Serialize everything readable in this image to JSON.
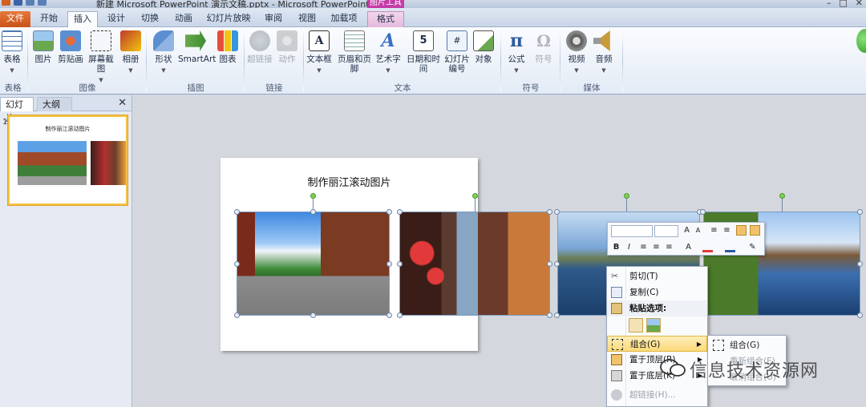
{
  "window": {
    "title": "新建 Microsoft PowerPoint 演示文稿.pptx - Microsoft PowerPoint",
    "context_tab_title": "图片工具",
    "controls": [
      "–",
      "□",
      "✕"
    ]
  },
  "tabs": [
    {
      "label": "文件",
      "state": "file"
    },
    {
      "label": "开始",
      "state": ""
    },
    {
      "label": "插入",
      "state": "active"
    },
    {
      "label": "设计",
      "state": ""
    },
    {
      "label": "切换",
      "state": ""
    },
    {
      "label": "动画",
      "state": ""
    },
    {
      "label": "幻灯片放映",
      "state": ""
    },
    {
      "label": "审阅",
      "state": ""
    },
    {
      "label": "视图",
      "state": ""
    },
    {
      "label": "加载项",
      "state": ""
    },
    {
      "label": "格式",
      "state": "ctx"
    }
  ],
  "ribbon": {
    "commands": [
      {
        "label": "表格",
        "icon": "table-icon",
        "dd": true
      },
      {
        "label": "图片",
        "icon": "picture-icon"
      },
      {
        "label": "剪贴画",
        "icon": "clipart-icon"
      },
      {
        "label": "屏幕截图",
        "icon": "screenshot-icon",
        "dd": true
      },
      {
        "label": "相册",
        "icon": "album-icon",
        "dd": true
      },
      {
        "label": "形状",
        "icon": "shapes-icon",
        "dd": true
      },
      {
        "label": "SmartArt",
        "icon": "smartart-icon"
      },
      {
        "label": "图表",
        "icon": "chart-icon"
      },
      {
        "label": "超链接",
        "icon": "hyperlink-icon",
        "disabled": true
      },
      {
        "label": "动作",
        "icon": "action-icon",
        "disabled": true
      },
      {
        "label": "文本框",
        "icon": "textbox-icon",
        "dd": true
      },
      {
        "label": "页眉和页脚",
        "icon": "header-footer-icon"
      },
      {
        "label": "艺术字",
        "icon": "wordart-icon",
        "dd": true
      },
      {
        "label": "日期和时间",
        "icon": "datetime-icon"
      },
      {
        "label": "幻灯片\n编号",
        "icon": "slide-number-icon"
      },
      {
        "label": "对象",
        "icon": "object-icon"
      },
      {
        "label": "公式",
        "icon": "equation-icon",
        "dd": true
      },
      {
        "label": "符号",
        "icon": "symbol-icon",
        "disabled": true
      },
      {
        "label": "视频",
        "icon": "video-icon",
        "dd": true
      },
      {
        "label": "音频",
        "icon": "audio-icon",
        "dd": true
      }
    ],
    "groups": [
      "表格",
      "图像",
      "插图",
      "链接",
      "文本",
      "符号",
      "媒体"
    ]
  },
  "pane": {
    "tabs": [
      "幻灯片",
      "大纲"
    ],
    "close": "✕",
    "slide_number": "1",
    "thumb_title": "制作丽江滚动图片"
  },
  "slide": {
    "title": "制作丽江滚动图片"
  },
  "mini_toolbar": {
    "buttons": [
      "B",
      "I",
      "A"
    ]
  },
  "context_menu": {
    "items": [
      {
        "label": "剪切(T)",
        "icon": "cut-icon"
      },
      {
        "label": "复制(C)",
        "icon": "copy-icon"
      },
      {
        "label": "粘贴选项:",
        "icon": "paste-icon",
        "head": true
      },
      {
        "label": "",
        "icon": "paste-options"
      },
      {
        "label": "组合(G)",
        "icon": "group-icon",
        "highlight": true,
        "submenu": true
      },
      {
        "label": "置于顶层(R)",
        "icon": "bring-front-icon",
        "submenu": true
      },
      {
        "label": "置于底层(K)",
        "icon": "send-back-icon",
        "submenu": true
      },
      {
        "label": "超链接(H)...",
        "icon": "hyperlink-icon",
        "disabled": true
      }
    ]
  },
  "submenu": {
    "items": [
      {
        "label": "组合(G)",
        "disabled": false
      },
      {
        "label": "重新组合(E)",
        "disabled": true
      },
      {
        "label": "取消组合(U)",
        "disabled": true
      }
    ]
  },
  "watermark": {
    "text": "信息技术资源网"
  },
  "colors": {
    "file_tab": "#d2601f",
    "context_tab": "#c43ba7",
    "highlight": "#fbd97a",
    "rotate_handle": "#7ed055"
  }
}
